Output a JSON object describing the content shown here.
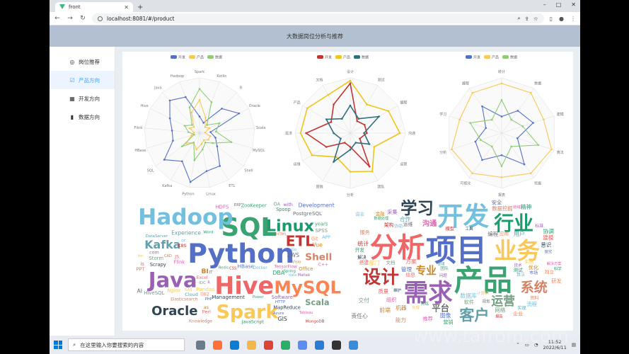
{
  "browser": {
    "tab_title": "front",
    "url": "localhost:8081/#/product",
    "new_tab": "+",
    "nav": {
      "back": "←",
      "forward": "→",
      "reload": "↻"
    },
    "window_controls": {
      "minimize": "–",
      "maximize": "□",
      "close": "✕"
    }
  },
  "app": {
    "title": "大数据岗位分析与推荐",
    "sidebar": [
      {
        "label": "岗位推荐",
        "icon": "◎",
        "active": false
      },
      {
        "label": "产品方向",
        "icon": "☑",
        "active": true
      },
      {
        "label": "开发方向",
        "icon": "▦",
        "active": false
      },
      {
        "label": "数据方向",
        "icon": "▮",
        "active": false
      }
    ]
  },
  "colors": {
    "dev": "#5470c6",
    "product": "#fac858",
    "data": "#91cc75",
    "red": "#c23531",
    "teal": "#2f4554"
  },
  "chart_data": [
    {
      "type": "radar",
      "legend": [
        "开发",
        "产品",
        "数据"
      ],
      "legend_colors": [
        "#5470c6",
        "#fac858",
        "#91cc75"
      ],
      "indicators": [
        "Spark",
        "Kotlin",
        "R",
        "Oracle",
        "Scala",
        "MySQL",
        "Shell",
        "ETL",
        "Linux",
        "Python",
        "Kafka",
        "SQL",
        "HBase",
        "Flink",
        "Hive",
        "Java",
        "Hadoop"
      ],
      "series": [
        {
          "values": [
            0.3,
            0.2,
            0.6,
            0.8,
            0.2,
            0.3,
            0.4,
            0.7,
            0.7,
            0.9,
            0.6,
            0.8,
            0.5,
            0.5,
            0.6,
            0.8,
            0.7
          ]
        },
        {
          "values": [
            0.6,
            0.3,
            0.15,
            0.2,
            0.1,
            0.2,
            0.2,
            0.15,
            0.2,
            0.3,
            0.2,
            0.3,
            0.15,
            0.1,
            0.2,
            0.15,
            0.4
          ]
        },
        {
          "values": [
            0.8,
            0.6,
            0.2,
            0.4,
            0.3,
            0.6,
            0.3,
            0.2,
            0.3,
            0.5,
            0.2,
            0.4,
            0.1,
            0.2,
            0.3,
            0.2,
            0.5
          ]
        }
      ]
    },
    {
      "type": "radar",
      "legend": [
        "开发",
        "产品",
        "数据"
      ],
      "legend_colors": [
        "#c23531",
        "#f0c419",
        "#2f6e7c"
      ],
      "indicators": [
        "设计",
        "测试",
        "编程",
        "沟通",
        "运营",
        "团队",
        "分析",
        "营销",
        "运维",
        "需求",
        "产品",
        "文档"
      ],
      "series": [
        {
          "values": [
            0.9,
            0.25,
            0.3,
            0.3,
            0.2,
            0.7,
            0.25,
            0.2,
            0.5,
            0.8,
            0.4,
            0.6
          ]
        },
        {
          "values": [
            0.95,
            0.6,
            0.8,
            0.9,
            0.5,
            0.8,
            0.7,
            0.5,
            0.8,
            0.9,
            0.9,
            0.8
          ]
        },
        {
          "values": [
            0.5,
            0.3,
            0.6,
            0.25,
            0.4,
            0.2,
            0.3,
            0.6,
            0.2,
            0.3,
            0.5,
            0.3
          ]
        }
      ]
    },
    {
      "type": "radar",
      "legend": [
        "开发",
        "产品",
        "数据"
      ],
      "legend_colors": [
        "#5470c6",
        "#fac858",
        "#91cc75"
      ],
      "indicators": [
        "统计",
        "数据",
        "建模",
        "算法",
        "挖掘",
        "报表",
        "可视化",
        "分析",
        "学习",
        "编程"
      ],
      "series": [
        {
          "values": [
            0.3,
            0.5,
            0.6,
            0.3,
            0.7,
            0.4,
            0.6,
            0.5,
            0.3,
            0.6
          ]
        },
        {
          "values": [
            0.9,
            0.9,
            0.8,
            0.95,
            0.9,
            0.8,
            0.9,
            0.95,
            0.8,
            0.9
          ]
        },
        {
          "values": [
            0.6,
            0.3,
            0.4,
            0.7,
            0.3,
            0.6,
            0.3,
            0.4,
            0.6,
            0.3
          ]
        }
      ]
    },
    {
      "type": "wordcloud",
      "words": [
        "Python",
        "SQL",
        "Hive",
        "Hadoop",
        "Java",
        "Spark",
        "MySQL",
        "Linux",
        "ETL",
        "Oracle",
        "Kafka",
        "Shell",
        "Scala",
        "BI",
        "IT",
        "Flink",
        "HBase",
        "Redis",
        "Excel",
        "Docker",
        "Matlab",
        "Pandas",
        "HTML",
        "Word",
        "CSS",
        "Management",
        "Experience",
        "Elasticsearch",
        "Storm",
        "Visio",
        "AWS",
        "TensorFlow",
        "HTTP",
        "DBA",
        "JS",
        "Go",
        "R",
        "SAS",
        "DB2",
        "Spoop",
        "K8S",
        "Scrapy",
        "Cloud",
        "PPT",
        "SPSS",
        "Office",
        "ERP",
        "HDFS",
        "Azure",
        "Power",
        "Perl",
        "APP",
        "Software",
        "Nginx",
        "Git",
        "Spring",
        "Kettle",
        "GIS",
        "DataServer",
        "Knowledge",
        "IDC",
        "Vue",
        "PostgreSQL",
        "Tableau",
        "Development",
        "ZooKeeper",
        "Business",
        "data",
        "with",
        "for",
        "NumPy",
        "JavaScript",
        "MongoDB",
        "MapReduce",
        "HiveSQL",
        "CAD",
        "OA",
        "as",
        "AI",
        "C++",
        "PHP",
        "years",
        "is",
        "or",
        "com"
      ]
    },
    {
      "type": "wordcloud",
      "words": [
        "项目",
        "产品",
        "分析",
        "开发",
        "需求",
        "业务",
        "数据分析",
        "行业",
        "设计",
        "学习",
        "客户",
        "系统",
        "运营",
        "专业",
        "平台",
        "沟通",
        "管理",
        "团队",
        "方案",
        "数据库",
        "问题",
        "实施",
        "应用",
        "测试",
        "模型",
        "工具",
        "用户",
        "数据挖掘",
        "软件",
        "机器",
        "运维",
        "组织",
        "市场",
        "熟练",
        "建模",
        "算法",
        "技术",
        "计算机",
        "研发",
        "协调",
        "架构",
        "维护",
        "合作",
        "服务",
        "文档",
        "优化",
        "规划",
        "解决方案",
        "研究",
        "数据处理",
        "质量",
        "流程",
        "标准",
        "部门",
        "独立",
        "精神",
        "统计",
        "解决",
        "实现",
        "资料",
        "网络",
        "金融",
        "编程",
        "领域",
        "安全",
        "营销",
        "信息",
        "协助",
        "采集",
        "处理",
        "企业",
        "科学",
        "报告",
        "意识",
        "逻辑",
        "能力",
        "交付",
        "前端",
        "责任心",
        "推荐",
        "图像",
        "开发",
        "搭建",
        "语言"
      ]
    }
  ],
  "taskbar": {
    "search_placeholder": "在这里输入你要搜索的内容",
    "time": "11:52",
    "date": "2022/6/11",
    "watermark": "www.tafrom.com"
  }
}
